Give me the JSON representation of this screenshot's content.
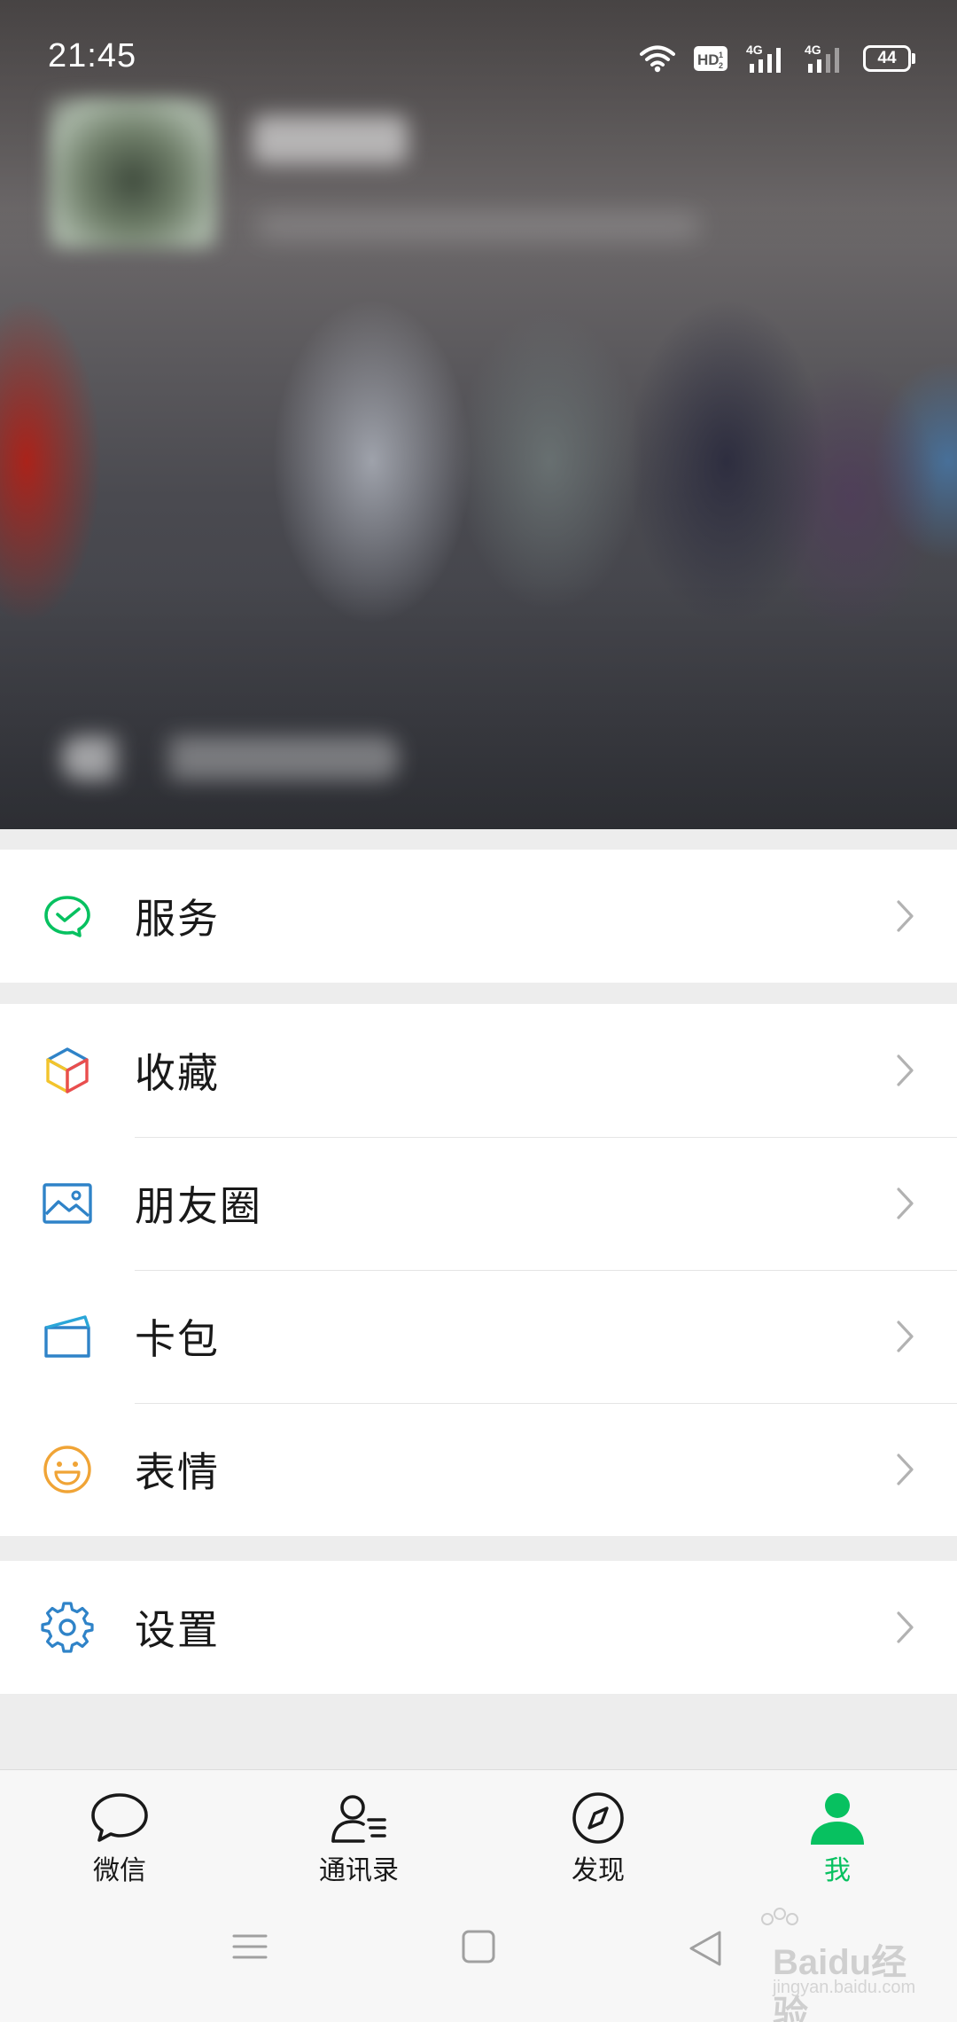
{
  "status_bar": {
    "time": "21:45",
    "hd_label": "HD",
    "network_1": "4G",
    "network_2": "4G",
    "battery": "44"
  },
  "profile_header": {
    "blurred": true
  },
  "menu": {
    "services": {
      "label": "服务",
      "icon": "wechat-pay-icon"
    },
    "favorites": {
      "label": "收藏",
      "icon": "cube-icon"
    },
    "moments": {
      "label": "朋友圈",
      "icon": "image-icon"
    },
    "cards": {
      "label": "卡包",
      "icon": "card-wallet-icon"
    },
    "stickers": {
      "label": "表情",
      "icon": "smiley-icon"
    },
    "settings": {
      "label": "设置",
      "icon": "gear-icon"
    }
  },
  "tabbar": {
    "chats": "微信",
    "contacts": "通讯录",
    "discover": "发现",
    "me": "我",
    "active": "me"
  },
  "watermark": {
    "brand": "Baidu",
    "suffix": "经验",
    "url": "jingyan.baidu.com"
  },
  "colors": {
    "accent": "#07c160",
    "icon_blue": "#2f83c8",
    "icon_orange": "#f0a436",
    "background": "#ededed"
  }
}
